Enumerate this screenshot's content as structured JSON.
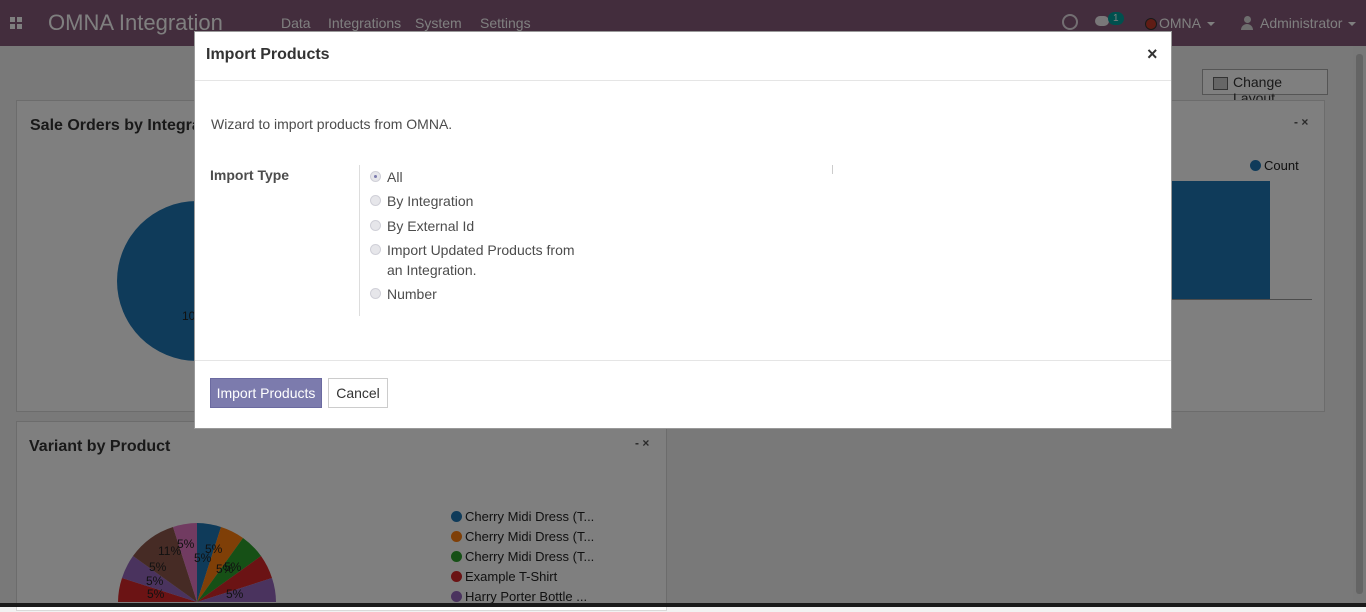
{
  "navbar": {
    "brand": "OMNA Integration",
    "menu": [
      "Data",
      "Integrations",
      "System",
      "Settings"
    ],
    "notification_count": "1",
    "company": "OMNA",
    "user": "Administrator"
  },
  "dashboard": {
    "change_layout_label": "Change Layout",
    "panel1": {
      "title": "Sale Orders by Integra",
      "pie_label": "10",
      "controls": "- ×"
    },
    "panel_right": {
      "legend": "Count",
      "controls": "- ×"
    },
    "panel2": {
      "title": "Variant by Product",
      "controls": "- ×",
      "legend": [
        {
          "label": "Cherry Midi Dress (T...",
          "color": "#1f77b4"
        },
        {
          "label": "Cherry Midi Dress (T...",
          "color": "#ff7f0e"
        },
        {
          "label": "Cherry Midi Dress (T...",
          "color": "#2ca02c"
        },
        {
          "label": "Example T-Shirt",
          "color": "#d62728"
        },
        {
          "label": "Harry Porter Bottle ...",
          "color": "#9467bd"
        }
      ],
      "pie_labels": [
        "5%",
        "5%",
        "11%",
        "5%",
        "5%",
        "5%",
        "5%",
        "5%",
        "5%",
        "5%",
        "5%"
      ]
    }
  },
  "modal": {
    "title": "Import Products",
    "close_symbol": "×",
    "description": "Wizard to import products from OMNA.",
    "field_label": "Import Type",
    "options": [
      {
        "label": "All",
        "checked": true
      },
      {
        "label": "By Integration",
        "checked": false
      },
      {
        "label": "By External Id",
        "checked": false
      },
      {
        "label": "Import Updated Products from an Integration.",
        "checked": false
      },
      {
        "label": "Number",
        "checked": false
      }
    ],
    "primary_button": "Import Products",
    "cancel_button": "Cancel"
  }
}
